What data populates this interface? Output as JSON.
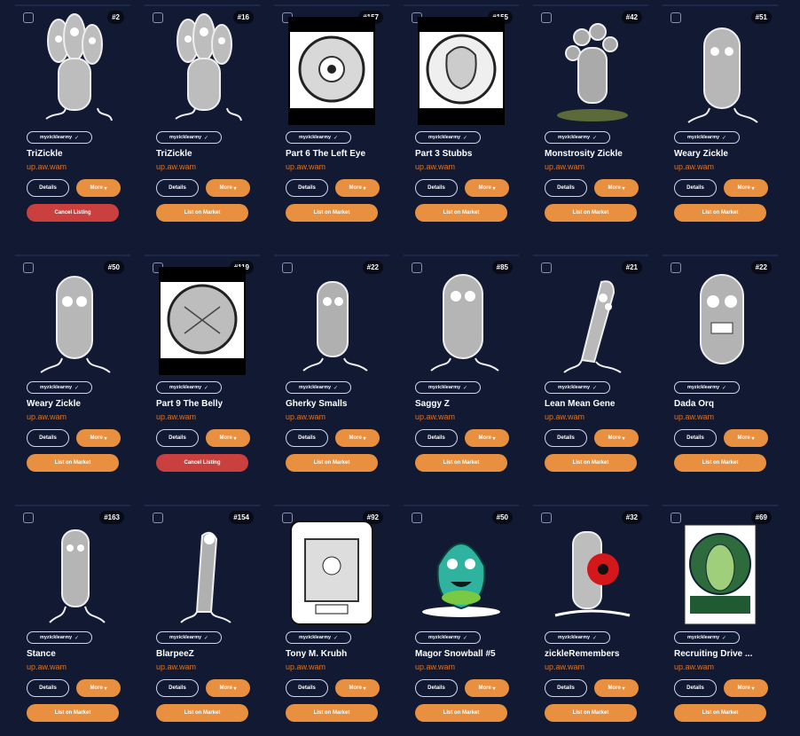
{
  "cards": [
    {
      "num": "#2",
      "title": "TriZickle",
      "owner": "up.aw.wam",
      "collection": "myzicklearmy",
      "more": "More",
      "details": "Details",
      "action": "Cancel Listing",
      "action_type": "cancel"
    },
    {
      "num": "#16",
      "title": "TriZickle",
      "owner": "up.aw.wam",
      "collection": "myzicklearmy",
      "more": "More",
      "details": "Details",
      "action": "List on Market",
      "action_type": "list"
    },
    {
      "num": "#157",
      "title": "Part 6 The Left Eye",
      "owner": "up.aw.wam",
      "collection": "myzicklearmy",
      "more": "More",
      "details": "Details",
      "action": "List on Market",
      "action_type": "list"
    },
    {
      "num": "#155",
      "title": "Part 3 Stubbs",
      "owner": "up.aw.wam",
      "collection": "myzicklearmy",
      "more": "More",
      "details": "Details",
      "action": "List on Market",
      "action_type": "list"
    },
    {
      "num": "#42",
      "title": "Monstrosity Zickle",
      "owner": "up.aw.wam",
      "collection": "myzicklearmy",
      "more": "More",
      "details": "Details",
      "action": "List on Market",
      "action_type": "list"
    },
    {
      "num": "#51",
      "title": "Weary Zickle",
      "owner": "up.aw.wam",
      "collection": "myzicklearmy",
      "more": "More",
      "details": "Details",
      "action": "List on Market",
      "action_type": "list"
    },
    {
      "num": "#50",
      "title": "Weary Zickle",
      "owner": "up.aw.wam",
      "collection": "myzicklearmy",
      "more": "More",
      "details": "Details",
      "action": "List on Market",
      "action_type": "list"
    },
    {
      "num": "#119",
      "title": "Part 9 The Belly",
      "owner": "up.aw.wam",
      "collection": "myzicklearmy",
      "more": "More",
      "details": "Details",
      "action": "Cancel Listing",
      "action_type": "cancel"
    },
    {
      "num": "#22",
      "title": "Gherky Smalls",
      "owner": "up.aw.wam",
      "collection": "myzicklearmy",
      "more": "More",
      "details": "Details",
      "action": "List on Market",
      "action_type": "list"
    },
    {
      "num": "#85",
      "title": "Saggy Z",
      "owner": "up.aw.wam",
      "collection": "myzicklearmy",
      "more": "More",
      "details": "Details",
      "action": "List on Market",
      "action_type": "list"
    },
    {
      "num": "#21",
      "title": "Lean Mean Gene",
      "owner": "up.aw.wam",
      "collection": "myzicklearmy",
      "more": "More",
      "details": "Details",
      "action": "List on Market",
      "action_type": "list"
    },
    {
      "num": "#22",
      "title": "Dada Orq",
      "owner": "up.aw.wam",
      "collection": "myzicklearmy",
      "more": "More",
      "details": "Details",
      "action": "List on Market",
      "action_type": "list"
    },
    {
      "num": "#163",
      "title": "Stance",
      "owner": "up.aw.wam",
      "collection": "myzicklearmy",
      "more": "More",
      "details": "Details",
      "action": "List on Market",
      "action_type": "list"
    },
    {
      "num": "#154",
      "title": "BlarpeeZ",
      "owner": "up.aw.wam",
      "collection": "myzicklearmy",
      "more": "More",
      "details": "Details",
      "action": "List on Market",
      "action_type": "list"
    },
    {
      "num": "#92",
      "title": "Tony M. Krubh",
      "owner": "up.aw.wam",
      "collection": "myzicklearmy",
      "more": "More",
      "details": "Details",
      "action": "List on Market",
      "action_type": "list"
    },
    {
      "num": "#50",
      "title": "Magor Snowball #5",
      "owner": "up.aw.wam",
      "collection": "myzicklearmy",
      "more": "More",
      "details": "Details",
      "action": "List on Market",
      "action_type": "list"
    },
    {
      "num": "#32",
      "title": "zickleRemembers",
      "owner": "up.aw.wam",
      "collection": "myzicklearmy",
      "more": "More",
      "details": "Details",
      "action": "List on Market",
      "action_type": "list"
    },
    {
      "num": "#69",
      "title": "Recruiting Drive ...",
      "owner": "up.aw.wam",
      "collection": "myzicklearmy",
      "more": "More",
      "details": "Details",
      "action": "List on Market",
      "action_type": "list"
    }
  ],
  "colors": {
    "accent": "#e8903f",
    "cancel": "#c9403e",
    "owner": "#d9742b",
    "card": "#1a2344",
    "page": "#121a33"
  }
}
